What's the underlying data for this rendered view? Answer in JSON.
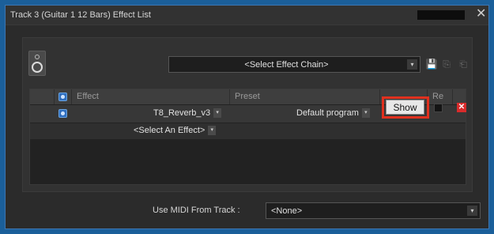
{
  "window": {
    "title": "Track 3 (Guitar 1 12 Bars) Effect List",
    "close_glyph": "✕"
  },
  "toolbar": {
    "chain_select_value": "<Select Effect Chain>",
    "dropdown_glyph": "▾",
    "save_glyph": "💾",
    "copy_glyph": "⎘",
    "paste_glyph": "⎗"
  },
  "table": {
    "headers": {
      "effect": "Effect",
      "preset": "Preset",
      "reset": "Re"
    },
    "rows": [
      {
        "effect": "T8_Reverb_v3",
        "preset": "Default program",
        "show_label": "Show",
        "remove_glyph": "✕"
      }
    ],
    "add_effect": "<Select An Effect>"
  },
  "midi": {
    "label": "Use MIDI From Track :",
    "value": "<None>"
  },
  "colors": {
    "highlight_box": "#e0301e",
    "remove_button": "#d92b2b",
    "enabled_check": "#2f6fc0",
    "outer_background": "#1b5f9a"
  }
}
